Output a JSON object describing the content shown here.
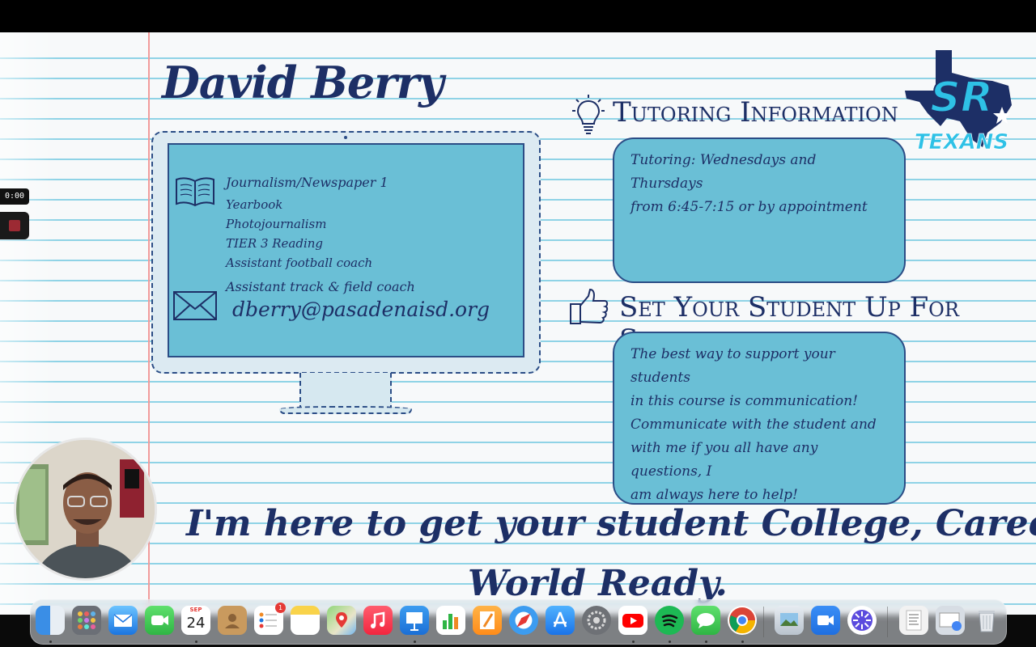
{
  "slide": {
    "teacher_name": "David Berry",
    "courses": [
      "Journalism/Newspaper 1",
      "Yearbook",
      "Photojournalism",
      "TIER 3 Reading",
      "Assistant football coach",
      "Assistant track & field coach"
    ],
    "email": "dberry@pasadenaisd.org",
    "tutoring": {
      "heading": "Tutoring Information",
      "text_line1": "Tutoring: Wednesdays and Thursdays",
      "text_line2": "from 6:45-7:15 or by appointment"
    },
    "success": {
      "heading": "Set Your Student Up For Success",
      "lines": [
        "The best way to support your students",
        "in this course is communication!",
        "Communicate with the student and",
        "with me if you all have any questions, I",
        "am always here to help!"
      ]
    },
    "logo": {
      "monogram": "SR",
      "team": "TEXANS"
    },
    "closing_line1": "I'm here to get your student College, Career &",
    "closing_line2": "World Ready."
  },
  "recording": {
    "timer": "0:00"
  },
  "dock": {
    "calendar_month": "SEP",
    "calendar_day": "24",
    "reminders_badge": "1",
    "apps": [
      "Finder",
      "Launchpad",
      "Mail",
      "FaceTime",
      "Calendar",
      "Contacts",
      "Reminders",
      "Notes",
      "Maps",
      "Music",
      "Keynote",
      "Numbers",
      "Pages",
      "Safari",
      "App Store",
      "System Settings",
      "YouTube",
      "Spotify",
      "Messages",
      "Chrome",
      "Preview",
      "Zoom",
      "Perplexity",
      "Documents",
      "Downloads",
      "Trash"
    ]
  },
  "colors": {
    "navy": "#1d2f66",
    "box_blue": "#6abfd6",
    "line_blue": "#8fd3e6",
    "margin_red": "#f19b9b",
    "logo_cyan": "#2ec1e6"
  }
}
